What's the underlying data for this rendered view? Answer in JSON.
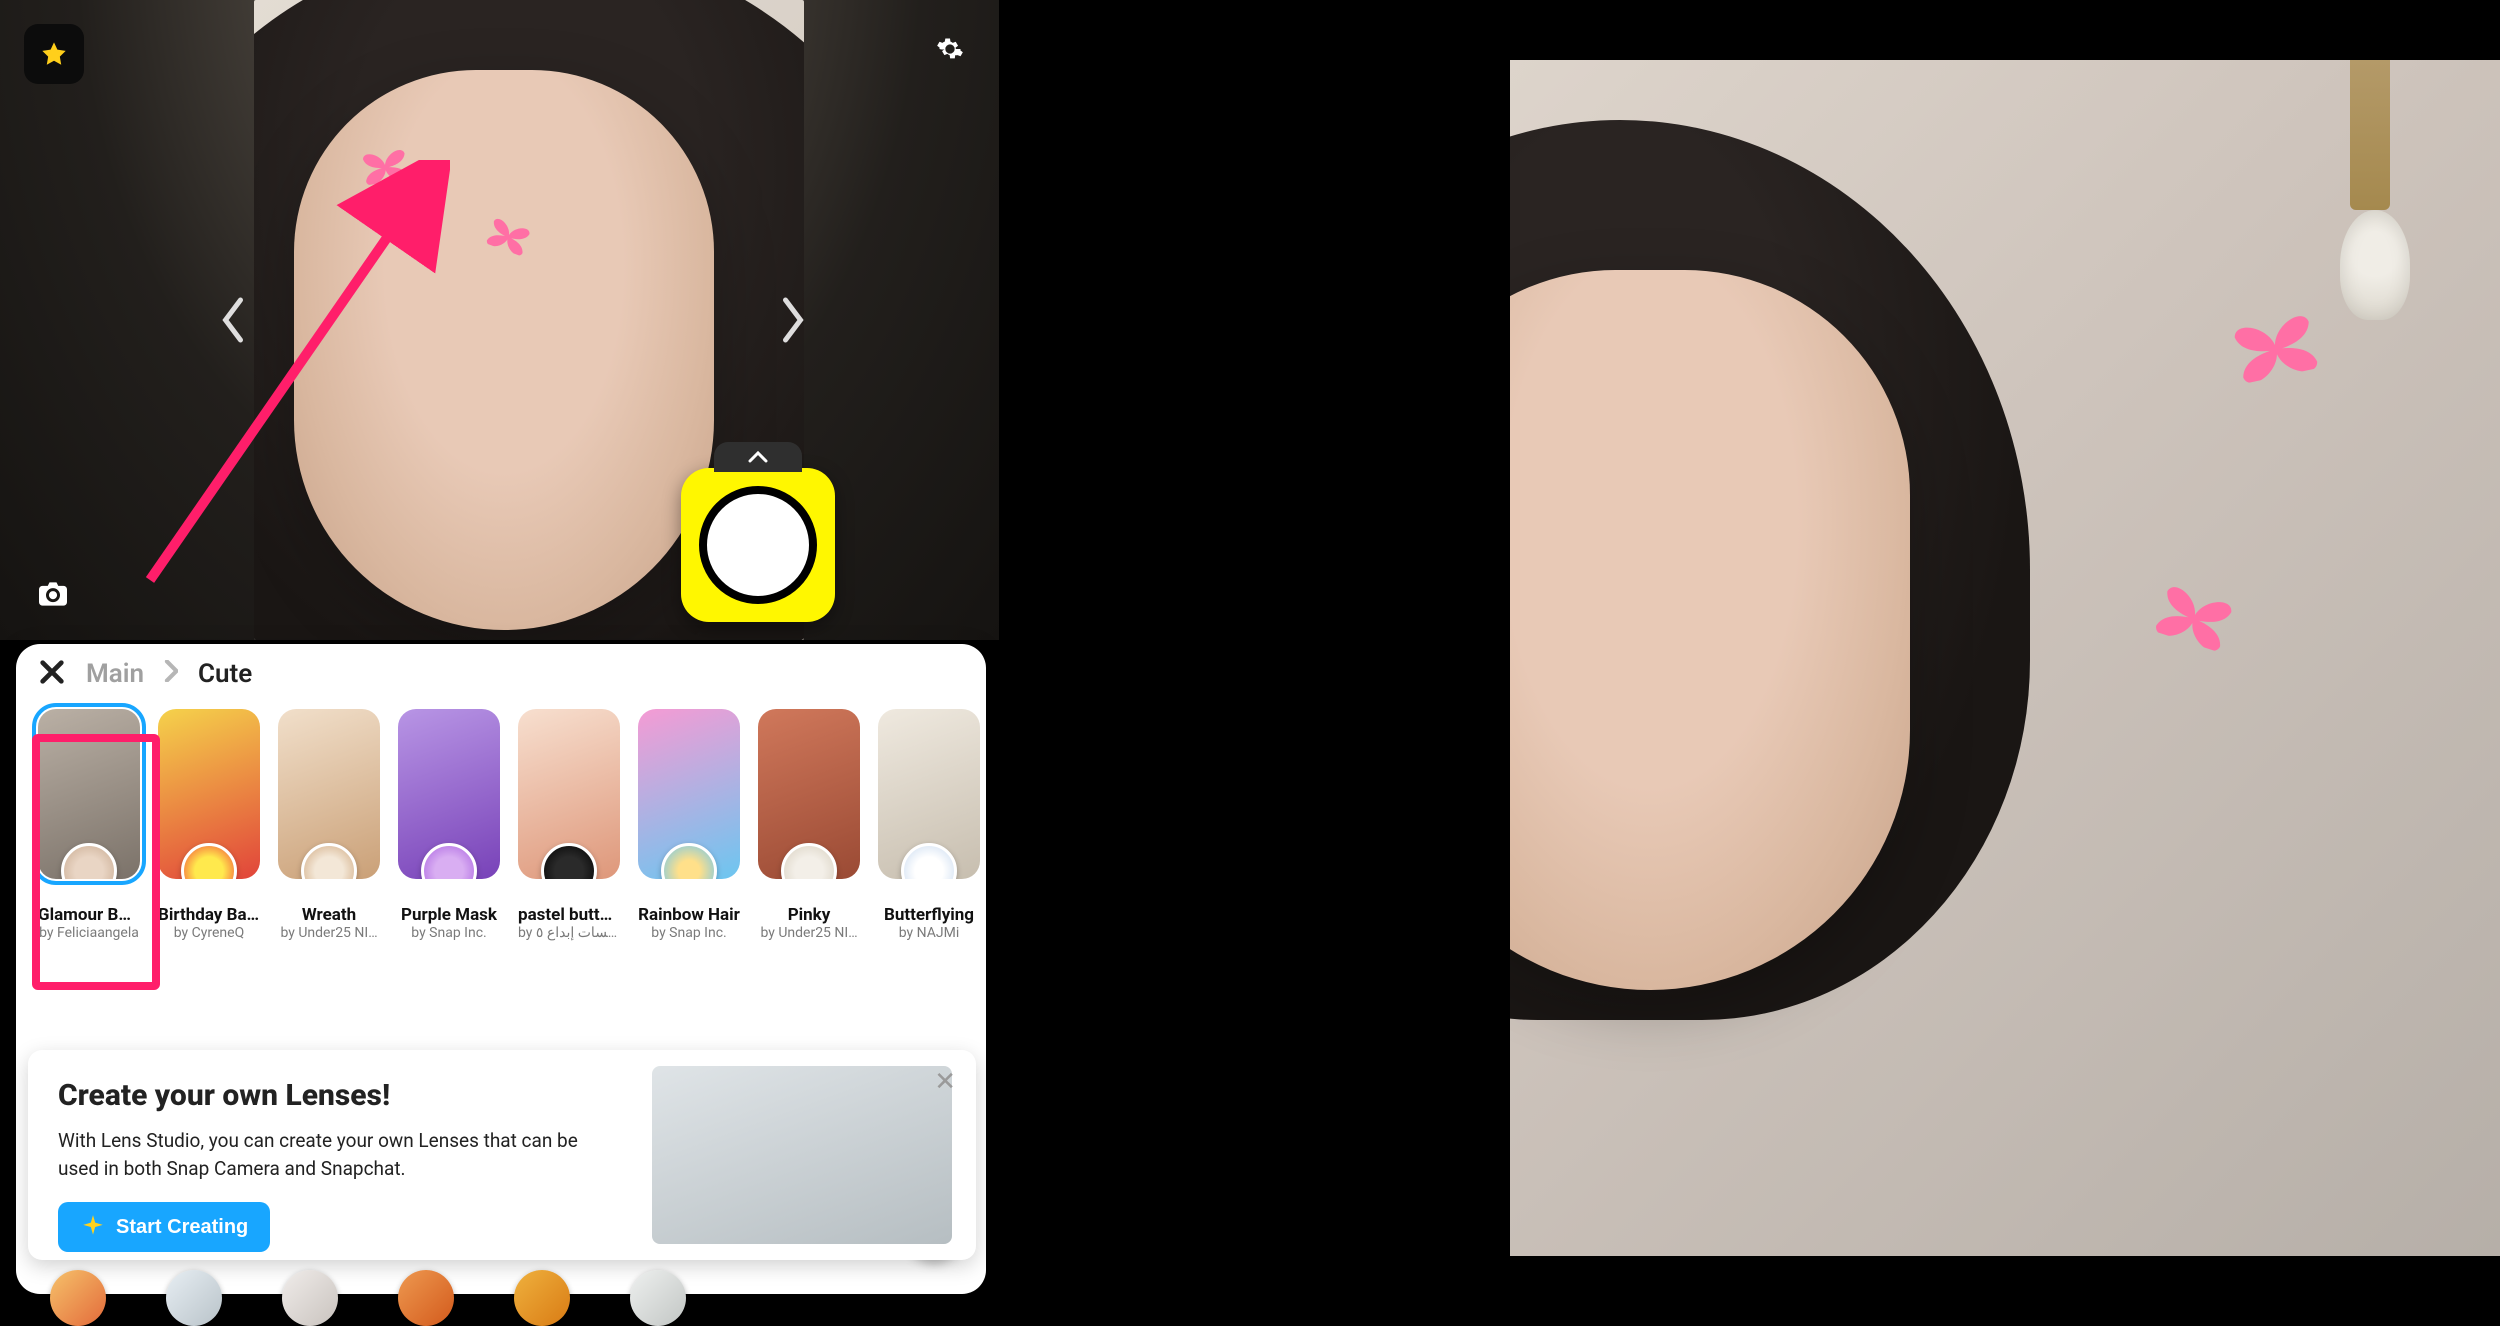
{
  "breadcrumb": {
    "root": "Main",
    "current": "Cute"
  },
  "lenses": [
    {
      "name": "Glamour Bu…",
      "author": "by Feliciaangela",
      "selected": true
    },
    {
      "name": "Birthday Bal…",
      "author": "by CyreneQ",
      "selected": false
    },
    {
      "name": "Wreath",
      "author": "by Under25 NI…",
      "selected": false
    },
    {
      "name": "Purple Mask",
      "author": "by Snap Inc.",
      "selected": false
    },
    {
      "name": "pastel butte…",
      "author": "by لمسات إبداع ٥",
      "selected": false
    },
    {
      "name": "Rainbow Hair",
      "author": "by Snap Inc.",
      "selected": false
    },
    {
      "name": "Pinky",
      "author": "by Under25 NI…",
      "selected": false
    },
    {
      "name": "Butterflying",
      "author": "by NAJMi",
      "selected": false
    }
  ],
  "promo": {
    "title": "Create your own Lenses!",
    "body": "With Lens Studio, you can create your own Lenses that can be used in both Snap Camera and Snapchat.",
    "cta": "Start Creating"
  },
  "icons": {
    "star": "star-icon",
    "gear": "gear-icon",
    "camera": "camera-icon",
    "prev": "chevron-left-icon",
    "next": "chevron-right-icon",
    "close": "close-icon",
    "up": "chevron-up-icon"
  },
  "colors": {
    "accent": "#18a6ff",
    "snapYellow": "#fff700",
    "highlight": "#ff1e6a"
  }
}
